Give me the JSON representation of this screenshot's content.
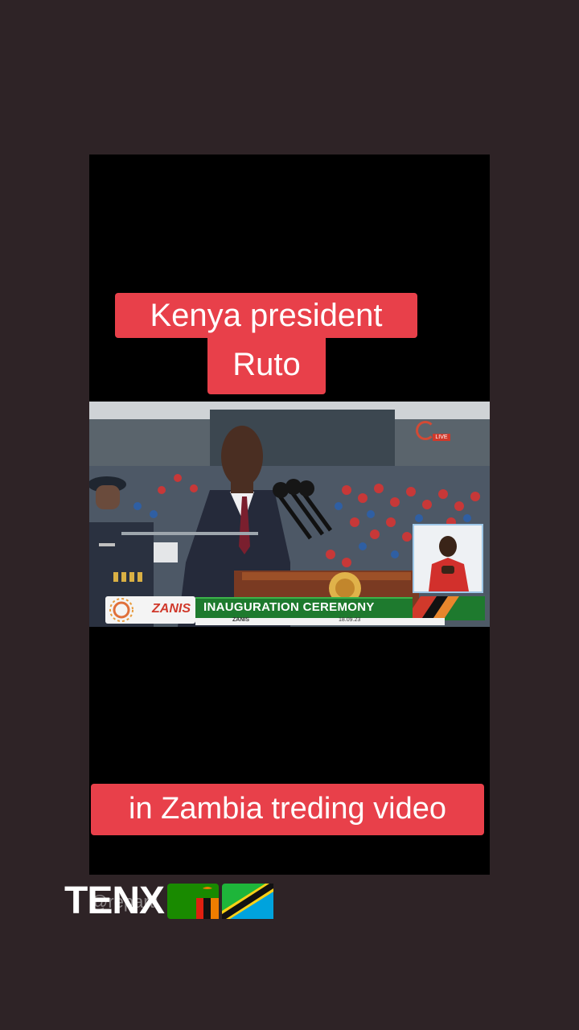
{
  "story": {
    "caption_top_line1": "Kenya president",
    "caption_top_line2": "Ruto",
    "caption_bottom": "in Zambia treding video",
    "username": "TENX",
    "watermark": "@reparti"
  },
  "broadcast": {
    "channel": "ZANIS",
    "banner": "INAUGURATION CEREMONY",
    "sub_channel": "ZANIS",
    "date": "18.09.23",
    "live": "LIVE"
  },
  "colors": {
    "background": "#2e2326",
    "caption_bg": "#e8404a",
    "caption_text": "#ffffff",
    "banner_green": "#1e7a2e"
  },
  "icons": {
    "flag_1": "zambia-flag",
    "flag_2": "tanzania-flag"
  }
}
